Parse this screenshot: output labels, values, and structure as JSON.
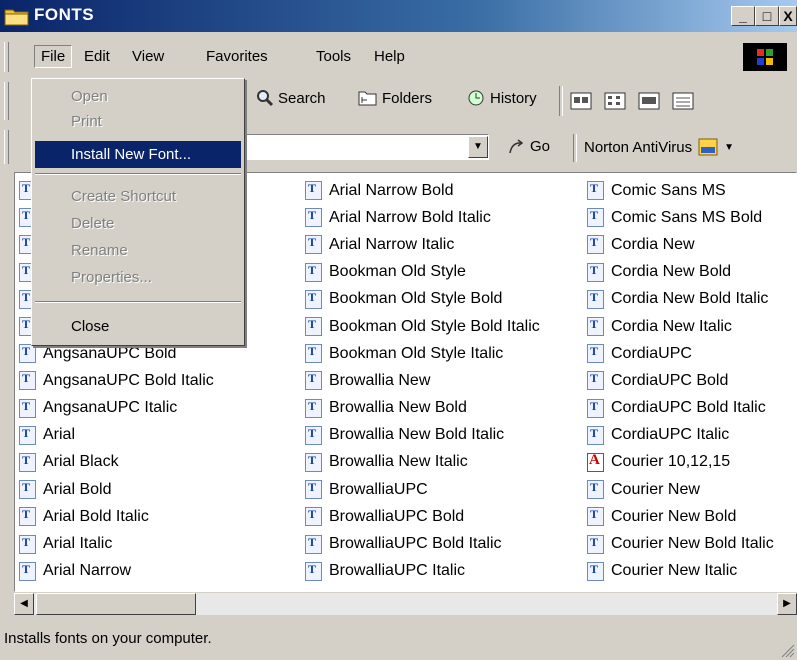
{
  "window": {
    "title": "FONTS",
    "caption_buttons": [
      "_",
      "□",
      "X"
    ]
  },
  "menubar": {
    "items": [
      "File",
      "Edit",
      "View",
      "Favorites",
      "Tools",
      "Help"
    ],
    "active": "File"
  },
  "toolbar": {
    "search": "Search",
    "folders": "Folders",
    "history": "History"
  },
  "addressbar": {
    "go": "Go",
    "norton": "Norton AntiVirus"
  },
  "file_menu": {
    "items": [
      {
        "label": "Open",
        "state": "disabled"
      },
      {
        "label": "Print",
        "state": "disabled"
      },
      {
        "label": "Install New Font...",
        "state": "highlighted"
      },
      {
        "label": "Create Shortcut",
        "state": "disabled"
      },
      {
        "label": "Delete",
        "state": "disabled"
      },
      {
        "label": "Rename",
        "state": "disabled"
      },
      {
        "label": "Properties...",
        "state": "disabled"
      },
      {
        "label": "Close",
        "state": "enabled"
      }
    ]
  },
  "fonts": {
    "col1": [
      "",
      "",
      "",
      "",
      "",
      "",
      "AngsanaUPC Bold",
      "AngsanaUPC Bold Italic",
      "AngsanaUPC Italic",
      "Arial",
      "Arial Black",
      "Arial Bold",
      "Arial Bold Italic",
      "Arial Italic",
      "Arial Narrow"
    ],
    "col2": [
      "Arial Narrow Bold",
      "Arial Narrow Bold Italic",
      "Arial Narrow Italic",
      "Bookman Old Style",
      "Bookman Old Style Bold",
      "Bookman Old Style Bold Italic",
      "Bookman Old Style Italic",
      "Browallia New",
      "Browallia New Bold",
      "Browallia New Bold Italic",
      "Browallia New Italic",
      "BrowalliaUPC",
      "BrowalliaUPC Bold",
      "BrowalliaUPC Bold Italic",
      "BrowalliaUPC Italic"
    ],
    "col3": [
      "Comic Sans MS",
      "Comic Sans MS Bold",
      "Cordia New",
      "Cordia New Bold",
      "Cordia New Bold Italic",
      "Cordia New Italic",
      "CordiaUPC",
      "CordiaUPC Bold",
      "CordiaUPC Bold Italic",
      "CordiaUPC Italic",
      "Courier 10,12,15",
      "Courier New",
      "Courier New Bold",
      "Courier New Bold Italic",
      "Courier New Italic"
    ],
    "raster_font": "Courier 10,12,15"
  },
  "statusbar": {
    "text": "Installs fonts on your computer."
  },
  "colors": {
    "title_start": "#0a246a",
    "title_end": "#a6caf0",
    "highlight": "#0a246a",
    "face": "#d4d0c8"
  }
}
